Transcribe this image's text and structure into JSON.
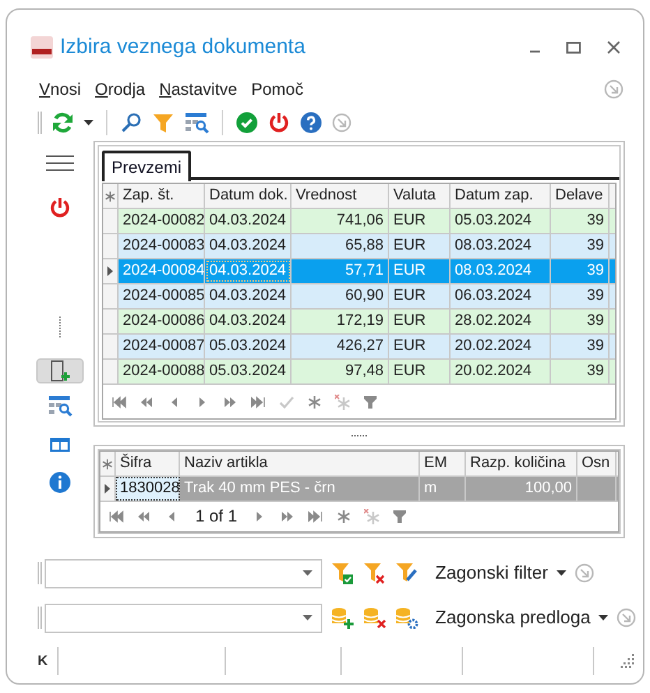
{
  "window": {
    "title": "Izbira veznega dokumenta"
  },
  "menu": [
    {
      "label": "Vnosi",
      "underlined": true
    },
    {
      "label": "Orodja",
      "underlined": true
    },
    {
      "label": "Nastavitve",
      "underlined": true
    },
    {
      "label": "Pomoč",
      "underlined": false
    }
  ],
  "tabs": [
    {
      "label": "Prevzemi",
      "selected": true
    }
  ],
  "documents": {
    "columns": [
      "Zap. št.",
      "Datum dok.",
      "Vrednost",
      "Valuta",
      "Datum zap.",
      "Delave"
    ],
    "rows": [
      {
        "cells": [
          "2024-00082",
          "04.03.2024",
          "741,06",
          "EUR",
          "05.03.2024",
          "39"
        ],
        "selected": false,
        "color": "#dcf6dc"
      },
      {
        "cells": [
          "2024-00083",
          "04.03.2024",
          "65,88",
          "EUR",
          "08.03.2024",
          "39"
        ],
        "selected": false,
        "color": "#d7ecfa"
      },
      {
        "cells": [
          "2024-00084",
          "04.03.2024",
          "57,71",
          "EUR",
          "08.03.2024",
          "39"
        ],
        "selected": true
      },
      {
        "cells": [
          "2024-00085",
          "04.03.2024",
          "60,90",
          "EUR",
          "06.03.2024",
          "39"
        ],
        "selected": false,
        "color": "#d7ecfa"
      },
      {
        "cells": [
          "2024-00086",
          "04.03.2024",
          "172,19",
          "EUR",
          "28.02.2024",
          "39"
        ],
        "selected": false,
        "color": "#dcf6dc"
      },
      {
        "cells": [
          "2024-00087",
          "05.03.2024",
          "426,27",
          "EUR",
          "20.02.2024",
          "39"
        ],
        "selected": false,
        "color": "#d7ecfa"
      },
      {
        "cells": [
          "2024-00088",
          "05.03.2024",
          "97,48",
          "EUR",
          "20.02.2024",
          "39"
        ],
        "selected": false,
        "color": "#dcf6dc"
      }
    ]
  },
  "items": {
    "columns": [
      "Šifra",
      "Naziv artikla",
      "EM",
      "Razp. količina",
      "Osn"
    ],
    "rows": [
      {
        "cells": [
          "1830028",
          "Trak 40 mm PES - črn",
          "m",
          "100,00",
          ""
        ],
        "selected": true
      }
    ],
    "pager": "1 of 1"
  },
  "filter": {
    "label": "Zagonski filter"
  },
  "template": {
    "label": "Zagonska predloga"
  },
  "status_bar": {
    "label": "K"
  }
}
